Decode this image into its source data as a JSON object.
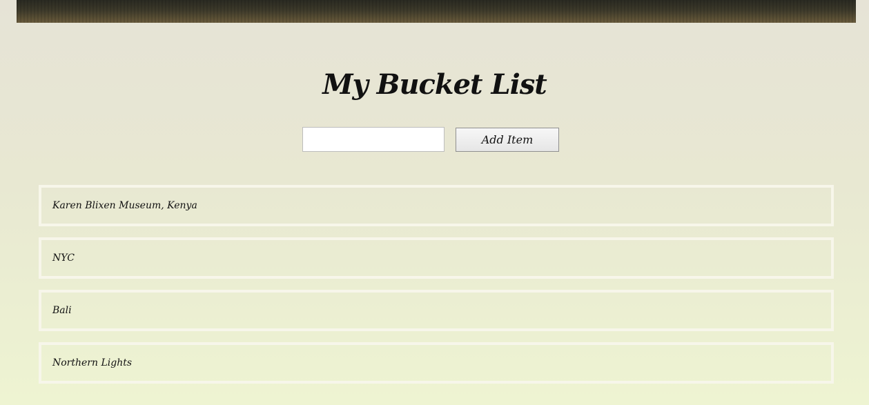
{
  "header": {
    "title": "My Bucket List"
  },
  "form": {
    "input_value": "",
    "input_placeholder": "",
    "add_label": "Add Item"
  },
  "list": {
    "items": [
      {
        "label": "Karen Blixen Museum, Kenya"
      },
      {
        "label": "NYC"
      },
      {
        "label": "Bali"
      },
      {
        "label": "Northern Lights"
      }
    ]
  },
  "colors": {
    "background_top": "#e6e3d6",
    "background_bottom": "#eef4d2",
    "item_border": "#f7f6ea",
    "text": "#111111"
  }
}
